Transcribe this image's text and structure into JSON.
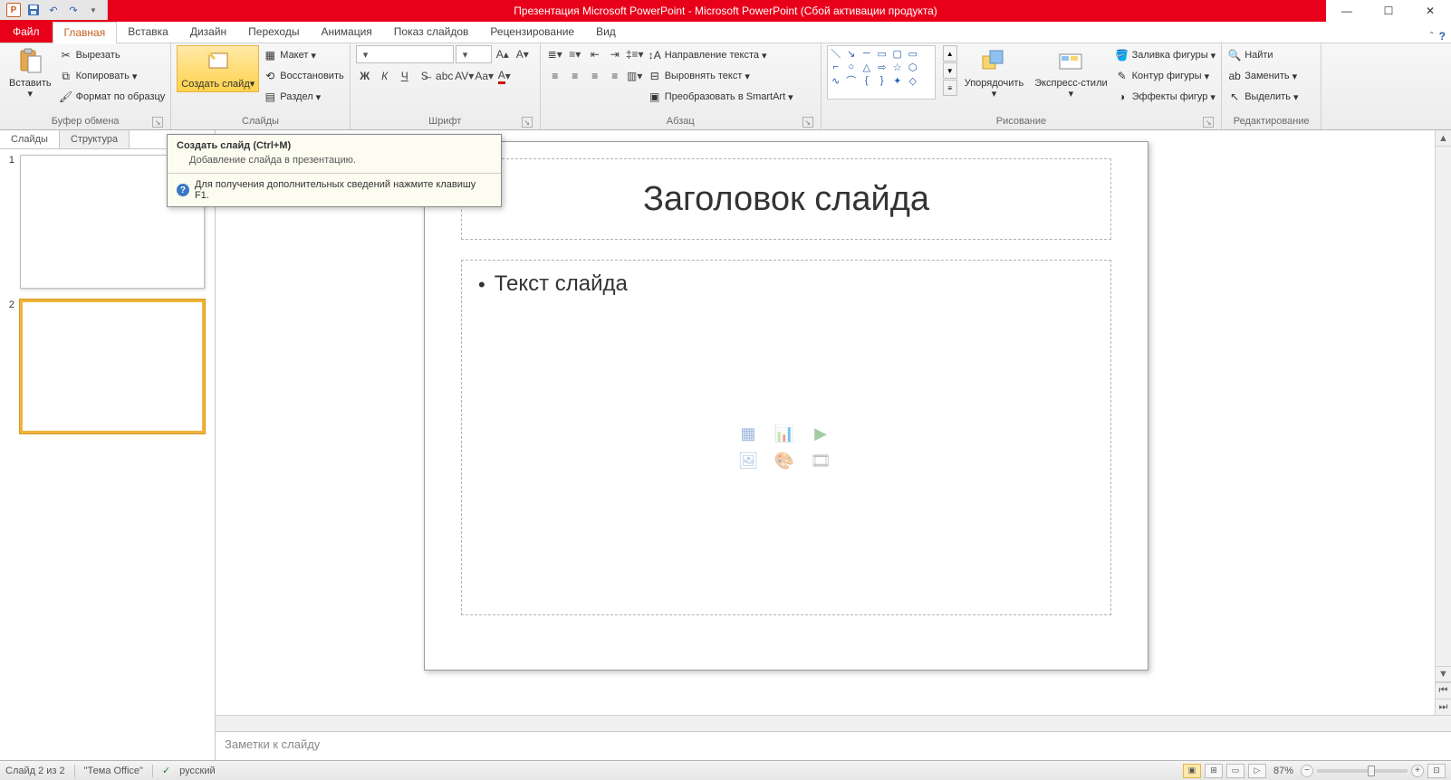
{
  "titlebar": {
    "title": "Презентация Microsoft PowerPoint  -  Microsoft PowerPoint (Сбой активации продукта)"
  },
  "ribbon_tabs": {
    "file": "Файл",
    "tabs": [
      "Главная",
      "Вставка",
      "Дизайн",
      "Переходы",
      "Анимация",
      "Показ слайдов",
      "Рецензирование",
      "Вид"
    ],
    "active": 0
  },
  "clipboard": {
    "paste": "Вставить",
    "cut": "Вырезать",
    "copy": "Копировать",
    "format_painter": "Формат по образцу",
    "group_label": "Буфер обмена"
  },
  "slides": {
    "new_slide": "Создать слайд",
    "layout": "Макет",
    "reset": "Восстановить",
    "section": "Раздел",
    "group_label": "Слайды"
  },
  "font": {
    "group_label": "Шрифт"
  },
  "paragraph": {
    "text_direction": "Направление текста",
    "align_text": "Выровнять текст",
    "convert_smartart": "Преобразовать в SmartArt",
    "group_label": "Абзац"
  },
  "drawing": {
    "arrange": "Упорядочить",
    "quick_styles": "Экспресс-стили",
    "shape_fill": "Заливка фигуры",
    "shape_outline": "Контур фигуры",
    "shape_effects": "Эффекты фигур",
    "group_label": "Рисование"
  },
  "editing": {
    "find": "Найти",
    "replace": "Заменить",
    "select": "Выделить",
    "group_label": "Редактирование"
  },
  "side": {
    "tab_slides": "Слайды",
    "tab_outline": "Структура",
    "thumbs": [
      "1",
      "2"
    ]
  },
  "slide": {
    "title_placeholder": "Заголовок слайда",
    "body_placeholder": "Текст слайда"
  },
  "notes": {
    "placeholder": "Заметки к слайду"
  },
  "tooltip": {
    "title": "Создать слайд (Ctrl+M)",
    "body": "Добавление слайда в презентацию.",
    "help": "Для получения дополнительных сведений нажмите клавишу F1."
  },
  "status": {
    "slide_info": "Слайд 2 из 2",
    "theme": "\"Тема Office\"",
    "language": "русский",
    "zoom": "87%"
  }
}
